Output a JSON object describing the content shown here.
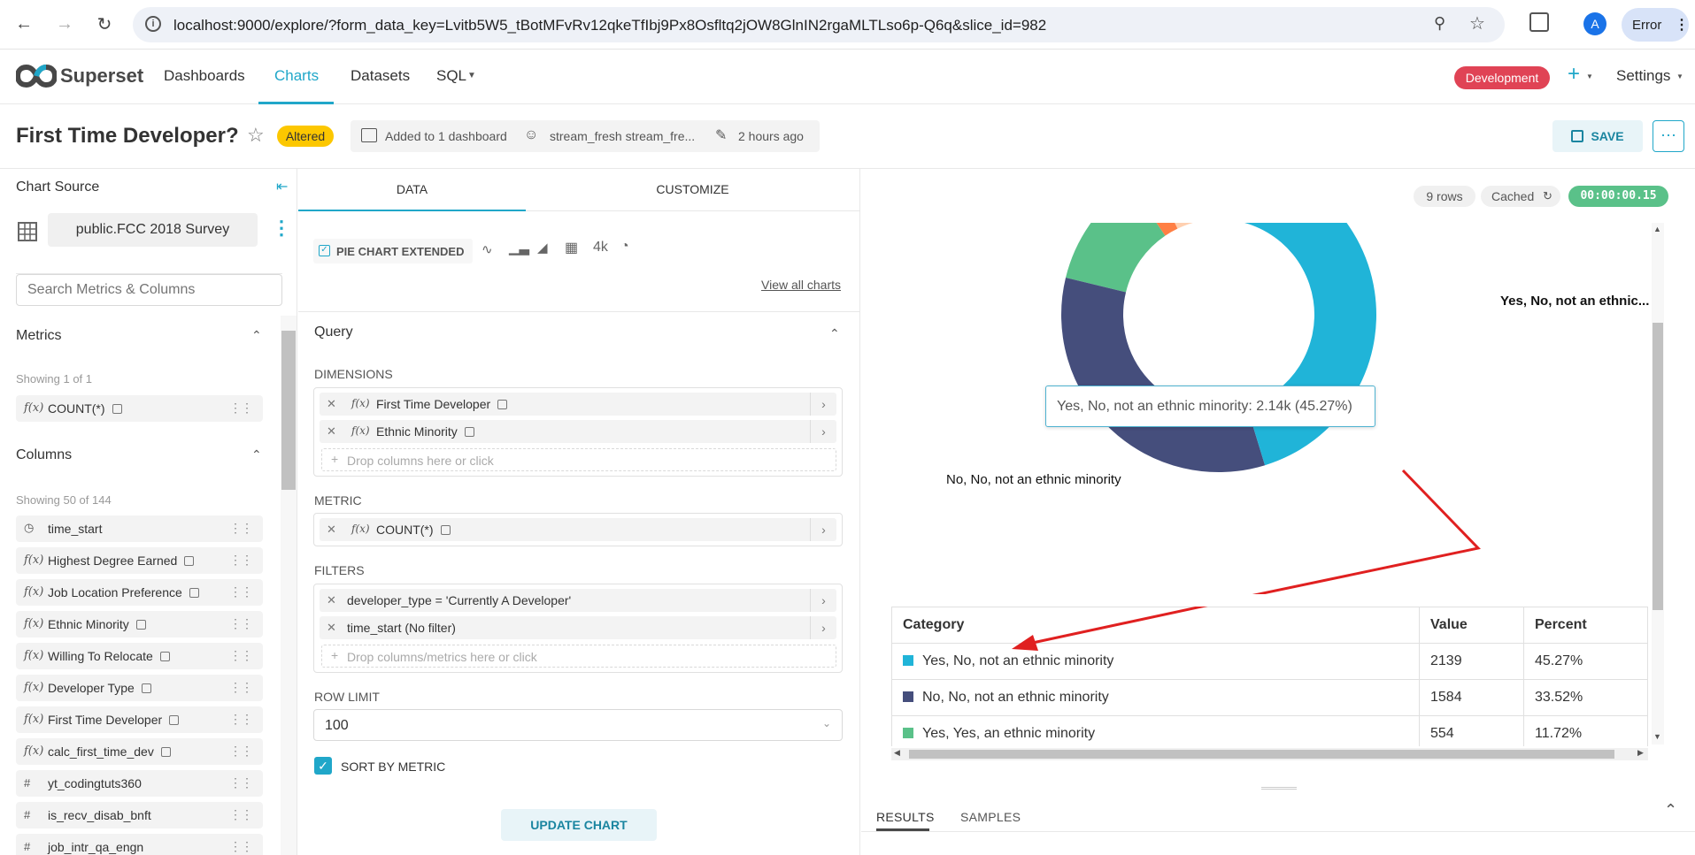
{
  "browser": {
    "url": "localhost:9000/explore/?form_data_key=Lvitb5W5_tBotMFvRv12qkeTfIbj9Px8Osfltq2jOW8GlnIN2rgaMLTLso6p-Q6q&slice_id=982",
    "profile_initial": "A",
    "error_label": "Error"
  },
  "app": {
    "brand": "Superset",
    "nav": [
      "Dashboards",
      "Charts",
      "Datasets",
      "SQL"
    ],
    "env_badge": "Development",
    "settings_label": "Settings"
  },
  "chart_header": {
    "title": "First Time Developer?",
    "altered_badge": "Altered",
    "dashboards": "Added to 1 dashboard",
    "owner": "stream_fresh stream_fre...",
    "modified": "2 hours ago",
    "save_label": "SAVE"
  },
  "datasource": {
    "heading": "Chart Source",
    "name": "public.FCC 2018 Survey",
    "search_placeholder": "Search Metrics & Columns",
    "metrics_heading": "Metrics",
    "metrics_count": "Showing 1 of 1",
    "metrics": [
      {
        "icon": "f(x)",
        "name": "COUNT(*)"
      }
    ],
    "columns_heading": "Columns",
    "columns_count": "Showing 50 of 144",
    "columns": [
      {
        "icon": "clock",
        "name": "time_start",
        "calc": false
      },
      {
        "icon": "f(x)",
        "name": "Highest Degree Earned",
        "calc": true
      },
      {
        "icon": "f(x)",
        "name": "Job Location Preference",
        "calc": true
      },
      {
        "icon": "f(x)",
        "name": "Ethnic Minority",
        "calc": true
      },
      {
        "icon": "f(x)",
        "name": "Willing To Relocate",
        "calc": true
      },
      {
        "icon": "f(x)",
        "name": "Developer Type",
        "calc": true
      },
      {
        "icon": "f(x)",
        "name": "First Time Developer",
        "calc": true
      },
      {
        "icon": "f(x)",
        "name": "calc_first_time_dev",
        "calc": true
      },
      {
        "icon": "#",
        "name": "yt_codingtuts360",
        "calc": false
      },
      {
        "icon": "#",
        "name": "is_recv_disab_bnft",
        "calc": false
      },
      {
        "icon": "#",
        "name": "job_intr_qa_engn",
        "calc": false
      }
    ]
  },
  "control_panel": {
    "tabs": [
      "DATA",
      "CUSTOMIZE"
    ],
    "viz_type": "PIE CHART EXTENDED",
    "view_all": "View all charts",
    "quick_4k": "4k",
    "query_heading": "Query",
    "dimensions_label": "DIMENSIONS",
    "dimensions": [
      "First Time Developer",
      "Ethnic Minority"
    ],
    "dimensions_hint": "Drop columns here or click",
    "metric_label": "METRIC",
    "metric": "COUNT(*)",
    "filters_label": "FILTERS",
    "filters": [
      "developer_type = 'Currently A Developer'",
      "time_start (No filter)"
    ],
    "filters_hint": "Drop columns/metrics here or click",
    "row_limit_label": "ROW LIMIT",
    "row_limit": "100",
    "sort_by_metric": "SORT BY METRIC",
    "update_label": "UPDATE CHART"
  },
  "results": {
    "rows": "9 rows",
    "cached": "Cached",
    "timer": "00:00:00.15",
    "tabs": [
      "RESULTS",
      "SAMPLES"
    ]
  },
  "chart_data": {
    "type": "pie",
    "donut": true,
    "tooltip": "Yes, No, not an ethnic minority: 2.14k (45.27%)",
    "outer_labels": [
      "Yes, No, not an ethnic...",
      "No, No, not an ethnic minority"
    ],
    "table_headers": [
      "Category",
      "Value",
      "Percent"
    ],
    "slices": [
      {
        "name": "Yes, No, not an ethnic minority",
        "value": 2139,
        "percent": "45.27%",
        "color": "#20b4d8"
      },
      {
        "name": "No, No, not an ethnic minority",
        "value": 1584,
        "percent": "33.52%",
        "color": "#454e7c"
      },
      {
        "name": "Yes, Yes, an ethnic minority",
        "value": 554,
        "percent": "11.72%",
        "color": "#5ac189"
      }
    ],
    "visible_other_color": "#ff7f44"
  }
}
